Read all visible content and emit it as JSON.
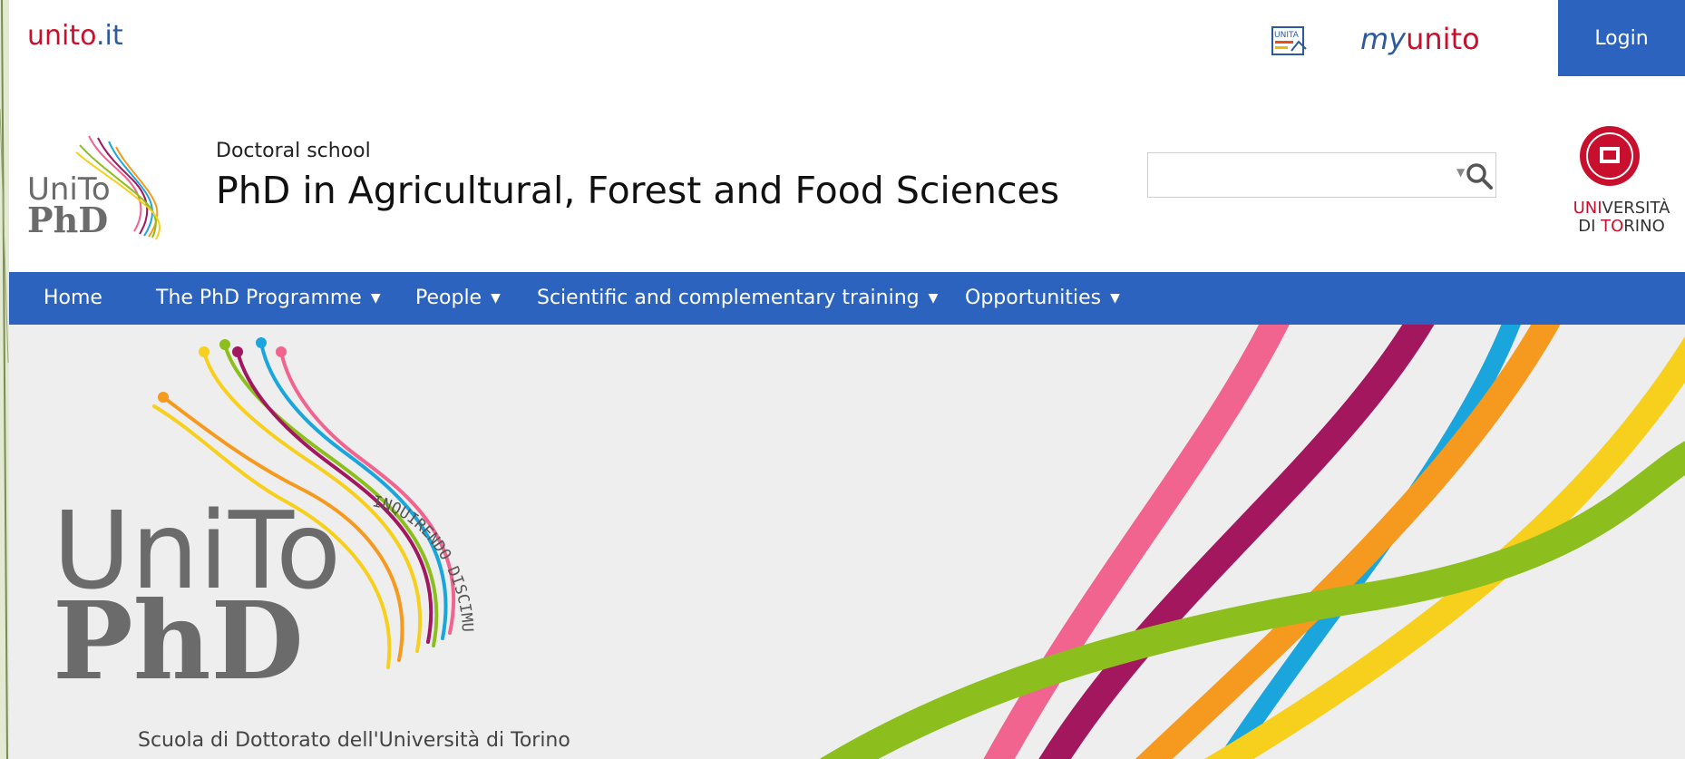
{
  "topbar": {
    "site_link_1": "unito",
    "site_link_2": ".it",
    "unita_icon": "UNITA",
    "myunito_1": "my",
    "myunito_2": "unito",
    "login_label": "Login"
  },
  "header": {
    "logo_line1": "UniTo",
    "logo_line2": "PhD",
    "subtitle": "Doctoral school",
    "title": "PhD in Agricultural, Forest and Food Sciences",
    "search_value": "",
    "uni_name_1": "UNI",
    "uni_name_2": "VERSITÀ",
    "uni_name_3": "DI ",
    "uni_name_4": "TO",
    "uni_name_5": "RINO"
  },
  "nav": {
    "items": [
      {
        "label": "Home",
        "has_dropdown": false
      },
      {
        "label": "The PhD Programme",
        "has_dropdown": true
      },
      {
        "label": "People",
        "has_dropdown": true
      },
      {
        "label": "Scientific and complementary training",
        "has_dropdown": true
      },
      {
        "label": "Opportunities",
        "has_dropdown": true
      }
    ]
  },
  "hero": {
    "logo_line1": "UniTo",
    "logo_line2": "PhD",
    "motto": "INQUIRENDO DISCIMUS",
    "caption": "Scuola di Dottorato dell'Università di Torino"
  },
  "colors": {
    "nav_blue": "#2c63bf",
    "unito_red": "#c8102e",
    "hero_bg": "#eeeeee",
    "stripe_pink": "#f0648f",
    "stripe_magenta": "#a3175f",
    "stripe_cyan": "#1aa6dc",
    "stripe_orange": "#f59a1e",
    "stripe_yellow": "#f7cf1d",
    "stripe_green": "#8cbf1e"
  }
}
